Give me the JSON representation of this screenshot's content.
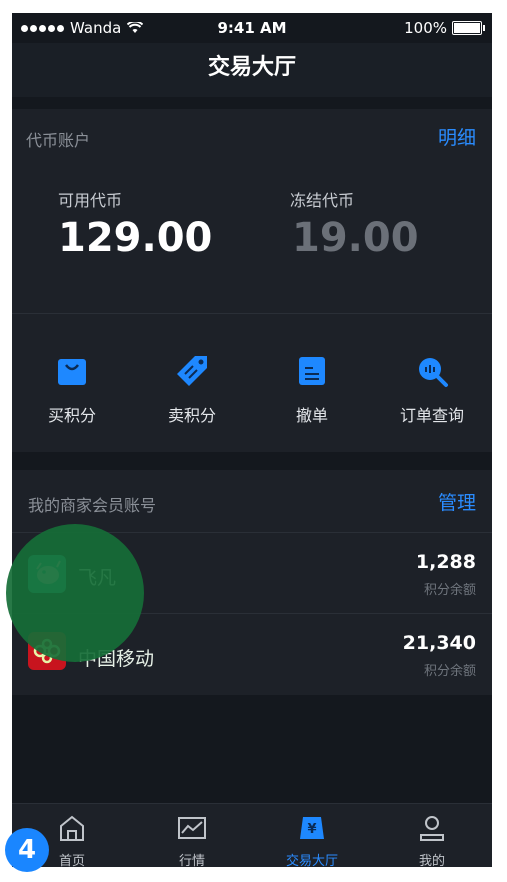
{
  "status_bar": {
    "carrier": "Wanda",
    "time": "9:41 AM",
    "battery": "100%"
  },
  "header": {
    "title": "交易大厅"
  },
  "wallet": {
    "title": "代币账户",
    "detail_link": "明细",
    "available": {
      "label": "可用代币",
      "value": "129.00"
    },
    "frozen": {
      "label": "冻结代币",
      "value": "19.00"
    }
  },
  "actions": [
    {
      "label": "买积分",
      "icon": "shopping-bag-icon"
    },
    {
      "label": "卖积分",
      "icon": "price-tag-icon"
    },
    {
      "label": "撤单",
      "icon": "cancel-order-icon"
    },
    {
      "label": "订单查询",
      "icon": "order-search-icon"
    }
  ],
  "merchant_accounts": {
    "title": "我的商家会员账号",
    "manage_link": "管理",
    "items": [
      {
        "name": "飞凡",
        "points": "1,288",
        "points_label": "积分余额",
        "icon": "feifan-logo",
        "color": "#3ad6c0"
      },
      {
        "name": "中国移动",
        "points": "21,340",
        "points_label": "积分余额",
        "icon": "china-mobile-logo",
        "color": "#c8141e"
      }
    ]
  },
  "tabbar": {
    "items": [
      {
        "label": "首页",
        "icon": "home-icon"
      },
      {
        "label": "行情",
        "icon": "chart-icon"
      },
      {
        "label": "交易大厅",
        "icon": "trading-hall-icon",
        "active": true
      },
      {
        "label": "我的",
        "icon": "user-icon"
      }
    ]
  },
  "step_badge": "4",
  "colors": {
    "accent": "#2a8cff",
    "background": "#14181e",
    "card": "#1d2128",
    "highlight": "#166e37"
  }
}
